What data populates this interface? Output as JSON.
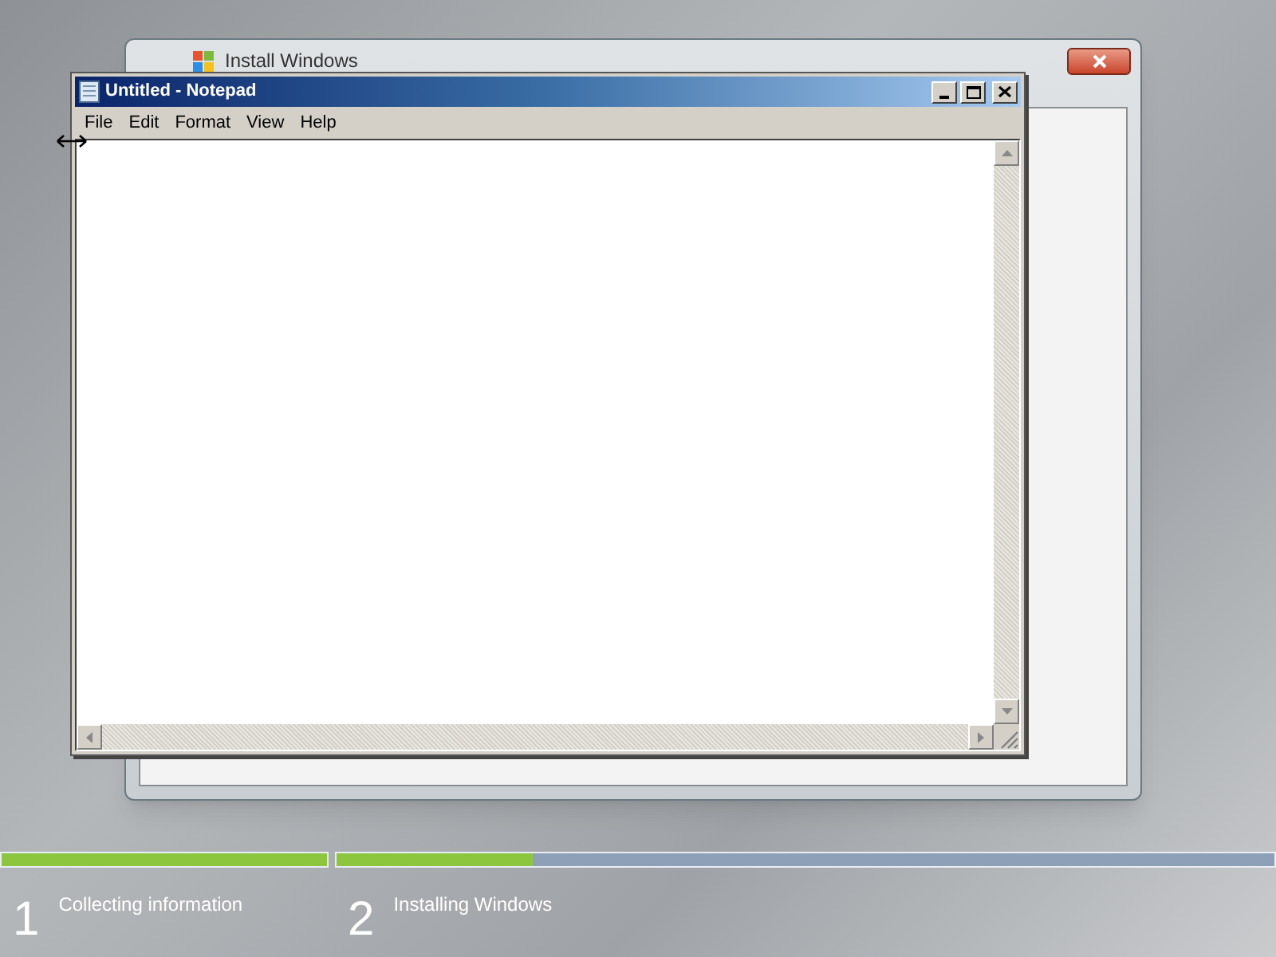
{
  "background_window": {
    "title": "Install Windows"
  },
  "notepad": {
    "title": "Untitled - Notepad",
    "menu": [
      "File",
      "Edit",
      "Format",
      "View",
      "Help"
    ]
  },
  "steps": [
    {
      "number": "1",
      "label": "Collecting information",
      "level": 1
    },
    {
      "number": "2",
      "label": "Installing Windows",
      "level": 0.21
    }
  ]
}
